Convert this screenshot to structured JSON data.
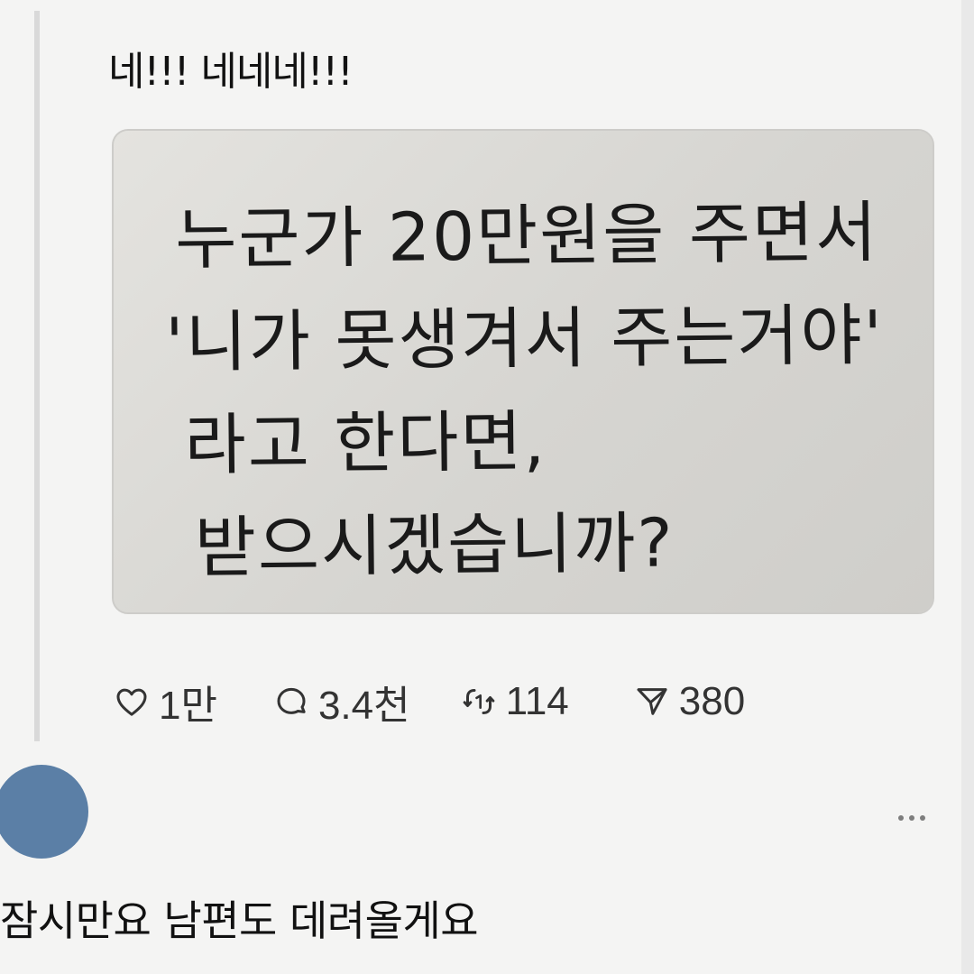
{
  "post": {
    "text": "네!!! 네네네!!!",
    "image_text": {
      "line1": "누군가 20만원을 주면서",
      "line2": "'니가 못생겨서 주는거야'",
      "line3": "라고 한다면,",
      "line4": "받으시겠습니까?"
    },
    "actions": {
      "like_count": "1만",
      "reply_count": "3.4천",
      "repost_count": "114",
      "share_count": "380"
    }
  },
  "reply": {
    "avatar_color": "#5b7fa6",
    "text": "잠시만요 남편도 데려올게요"
  },
  "icons": {
    "like": "heart-icon",
    "reply": "comment-bubble-icon",
    "repost": "repost-icon",
    "share": "send-icon",
    "more": "more-dots-icon"
  }
}
